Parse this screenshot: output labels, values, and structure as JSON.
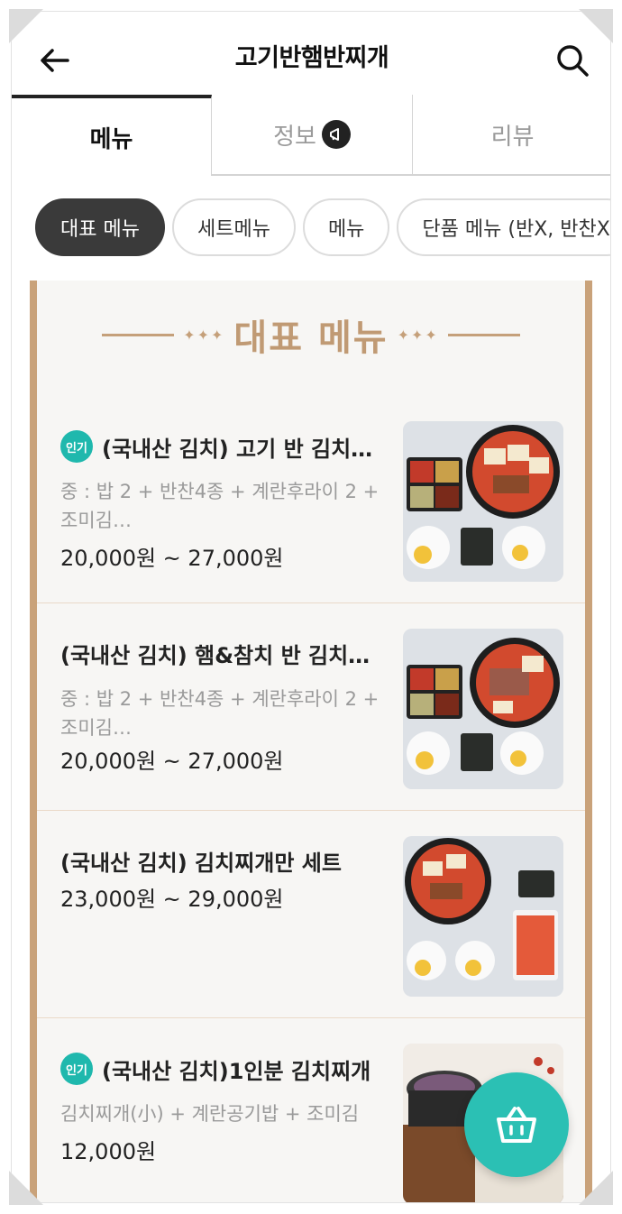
{
  "header": {
    "title": "고기반햄반찌개",
    "back_icon": "arrow-left-icon",
    "search_icon": "search-icon"
  },
  "tabs": [
    {
      "label": "메뉴"
    },
    {
      "label": "정보"
    },
    {
      "label": "리뷰"
    }
  ],
  "chips": [
    {
      "label": "대표 메뉴"
    },
    {
      "label": "세트메뉴"
    },
    {
      "label": "메뉴"
    },
    {
      "label": "단품 메뉴 (반X, 반찬X"
    }
  ],
  "section": {
    "title": "대표 메뉴",
    "dots": "✦✦✦"
  },
  "items": [
    {
      "badge": "인기",
      "name": "(국내산 김치) 고기 반 김치찌개",
      "desc": "중 : 밥 2 + 반찬4종 + 계란후라이 2 + 조미김…",
      "price": "20,000원 ~ 27,000원"
    },
    {
      "badge": "",
      "name": "(국내산 김치) 햄&참치 반 김치찌개",
      "desc": "중 : 밥 2 + 반찬4종 + 계란후라이 2 + 조미김…",
      "price": "20,000원 ~ 27,000원"
    },
    {
      "badge": "",
      "name": "(국내산 김치) 김치찌개만 세트",
      "desc": "",
      "price": "23,000원 ~ 29,000원"
    },
    {
      "badge": "인기",
      "name": "(국내산 김치)1인분 김치찌개",
      "desc": "김치찌개(小) + 계란공기밥 + 조미김",
      "price": "12,000원"
    }
  ],
  "colors": {
    "accent": "#2bc0b4",
    "badge": "#1fb8ad",
    "board_border": "#c9a27a",
    "section_title": "#c09a74"
  },
  "cart_icon": "basket-icon"
}
